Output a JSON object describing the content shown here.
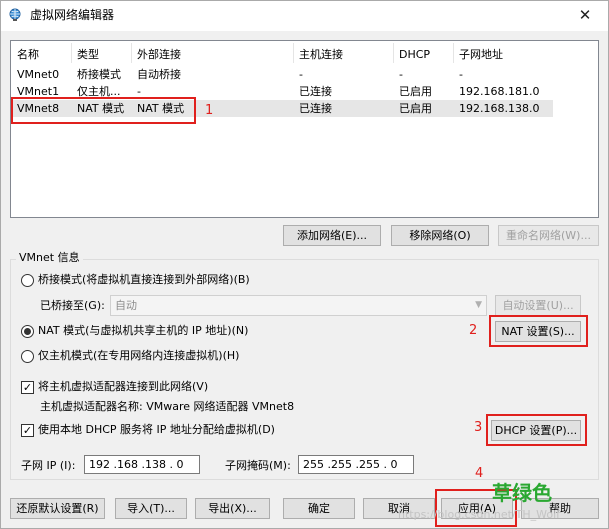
{
  "window": {
    "title": "虚拟网络编辑器",
    "close_glyph": "✕"
  },
  "table": {
    "headers": [
      "名称",
      "类型",
      "外部连接",
      "主机连接",
      "DHCP",
      "子网地址"
    ],
    "rows": [
      [
        "VMnet0",
        "桥接模式",
        "自动桥接",
        "-",
        "-",
        "-"
      ],
      [
        "VMnet1",
        "仅主机...",
        "-",
        "已连接",
        "已启用",
        "192.168.181.0"
      ],
      [
        "VMnet8",
        "NAT 模式",
        "NAT 模式",
        "已连接",
        "已启用",
        "192.168.138.0"
      ]
    ],
    "selected_row": "VMnet8"
  },
  "list_buttons": {
    "add": "添加网络(E)...",
    "remove": "移除网络(O)",
    "rename": "重命名网络(W)..."
  },
  "vmnet_info": {
    "legend": "VMnet 信息",
    "bridged_label": "桥接模式(将虚拟机直接连接到外部网络)(B)",
    "bridged_to_label": "已桥接至(G):",
    "bridged_to_value": "自动",
    "auto_settings": "自动设置(U)...",
    "nat_label": "NAT 模式(与虚拟机共享主机的 IP 地址)(N)",
    "nat_settings": "NAT 设置(S)...",
    "hostonly_label": "仅主机模式(在专用网络内连接虚拟机)(H)",
    "selected_mode": "nat",
    "connect_adapter_label": "将主机虚拟适配器连接到此网络(V)",
    "adapter_name_label": "主机虚拟适配器名称: VMware 网络适配器 VMnet8",
    "dhcp_label": "使用本地 DHCP 服务将 IP 地址分配给虚拟机(D)",
    "dhcp_settings": "DHCP 设置(P)...",
    "subnet_ip_label": "子网 IP (I):",
    "subnet_ip_value": "192 .168 .138 . 0",
    "subnet_mask_label": "子网掩码(M):",
    "subnet_mask_value": "255 .255 .255 . 0"
  },
  "bottom_buttons": {
    "restore": "还原默认设置(R)",
    "import": "导入(T)...",
    "export": "导出(X)...",
    "ok": "确定",
    "cancel": "取消",
    "apply": "应用(A)",
    "help": "帮助"
  },
  "annotations": {
    "n1": "1",
    "n2": "2",
    "n3": "3",
    "n4": "4",
    "green_text": "草绿色"
  },
  "watermark": "https://blog.csdn.net/TH_Wolf",
  "colors": {
    "annotation_red": "#e0201d",
    "annotation_green": "#2aa831",
    "selected_row": "#e6e6e6"
  }
}
